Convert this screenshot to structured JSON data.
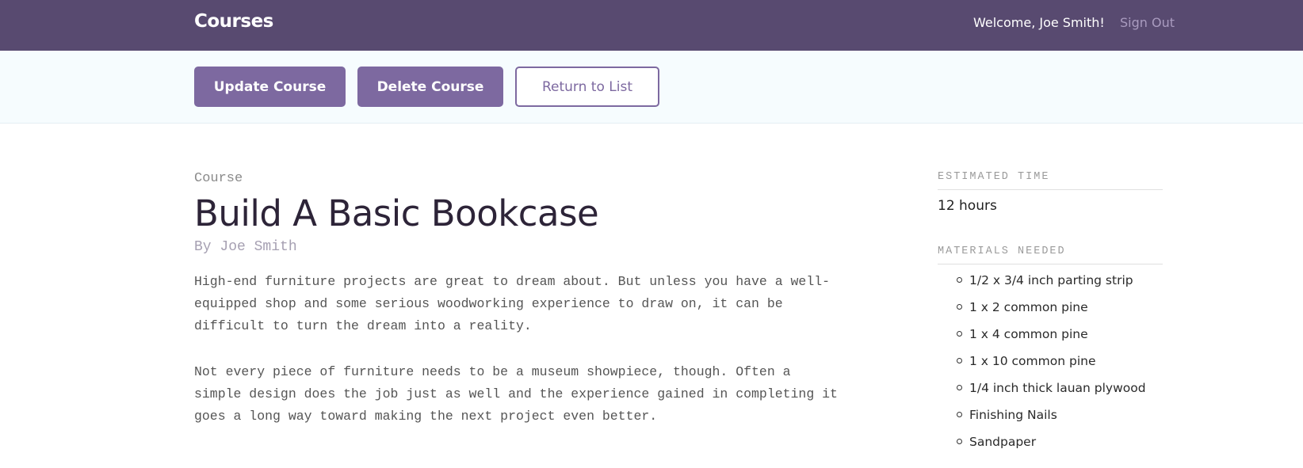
{
  "header": {
    "logo": "Courses",
    "welcome": "Welcome, Joe Smith!",
    "sign_out": "Sign Out"
  },
  "actions": {
    "update": "Update Course",
    "delete": "Delete Course",
    "return": "Return to List"
  },
  "course": {
    "label": "Course",
    "title": "Build A Basic Bookcase",
    "author": "By Joe Smith",
    "description": [
      "High-end furniture projects are great to dream about. But unless you have a well-equipped shop and some serious woodworking experience to draw on, it can be difficult to turn the dream into a reality.",
      "Not every piece of furniture needs to be a museum showpiece, though. Often a simple design does the job just as well and the experience gained in completing it goes a long way toward making the next project even better."
    ]
  },
  "sidebar": {
    "estimated_time_heading": "ESTIMATED TIME",
    "estimated_time": "12 hours",
    "materials_heading": "MATERIALS NEEDED",
    "materials": [
      "1/2 x 3/4 inch parting strip",
      "1 x 2 common pine",
      "1 x 4 common pine",
      "1 x 10 common pine",
      "1/4 inch thick lauan plywood",
      "Finishing Nails",
      "Sandpaper"
    ]
  },
  "colors": {
    "header_bg": "#584a70",
    "accent": "#7d69a0",
    "actions_bar_bg": "#f6fcfe"
  }
}
